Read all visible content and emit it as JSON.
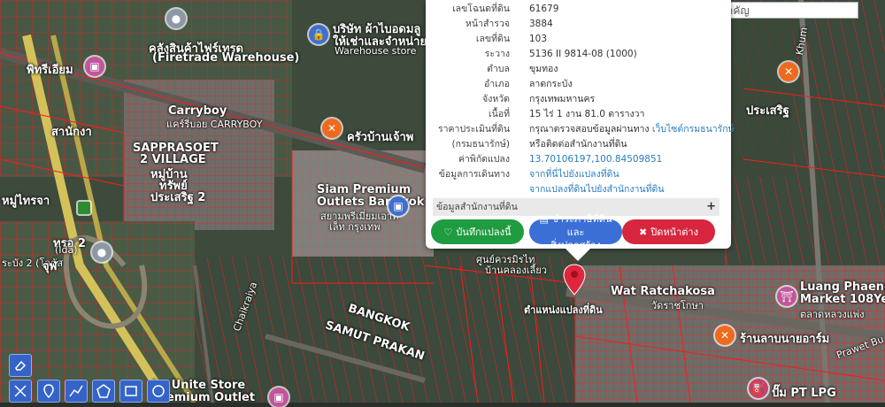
{
  "search": {
    "placeholder": "ค้นหาสถานที่สำคัญ"
  },
  "parcel": {
    "rows": [
      {
        "key": "เลขโฉนดที่ดิน",
        "value": "61679"
      },
      {
        "key": "หน้าสำรวจ",
        "value": "3884"
      },
      {
        "key": "เลขที่ดิน",
        "value": "103"
      },
      {
        "key": "ระวาง",
        "value": "5136 II 9814-08 (1000)"
      },
      {
        "key": "ตำบล",
        "value": "ขุมทอง"
      },
      {
        "key": "อำเภอ",
        "value": "ลาดกระบัง"
      },
      {
        "key": "จังหวัด",
        "value": "กรุงเทพมหานคร"
      },
      {
        "key": "เนื้อที่",
        "value": "15 ไร่ 1 งาน 81.0 ตารางวา"
      }
    ],
    "price_key": "ราคาประเมินที่ดิน",
    "price_key2": "(กรมธนารักษ์)",
    "price_value": "กรุณาตรวจสอบข้อมูลผ่านทาง",
    "price_link": "เว็บไซต์กรมธนารักษ์",
    "price_value2": "หรือติดต่อสำนักงานที่ดิน",
    "coord_key": "ค่าพิกัดแปลง",
    "coord_value": "13.70106197,100.84509851",
    "travel_key": "ข้อมูลการเดินทาง",
    "travel_link1": "จากที่นี่ไปยังแปลงที่ดิน",
    "travel_link2": "จากแปลงที่ดินไปยังสำนักงานที่ดิน",
    "office_label": "ข้อมูลสำนักงานที่ดิน",
    "office_plus": "+",
    "save_button": "บันทึกแปลงนี้",
    "pay_button_line1": "ชำระภาษีที่ดินและ",
    "pay_button_line2": "สิ่งปลูกสร้าง",
    "close_button": "ปิดหน้าต่าง"
  },
  "marker_label": "ตำแหน่งแปลงที่ดิน",
  "map_labels": {
    "firetrade_th": "คลังสินค้าไฟร์เทรด",
    "firetrade_en": "(Firetrade Warehouse)",
    "warehouse_th": "บริษัท ผ้าไบอดมลู",
    "warehouse_th2": "ให้เช่าและจำหน่าย",
    "warehouse_store": "Warehouse store",
    "carryboy_en": "Carryboy",
    "carryboy_th": "แคร์รี่บอย CARRYBOY",
    "krua": "ครัวบ้านเจ้าพ",
    "sapprasoet1": "SAPPRASOET",
    "sapprasoet2": "2 VILLAGE",
    "sapprasoet3": "หมู่บ้าน",
    "sapprasoet4": "ทรัพย์",
    "sapprasoet5": "ประเสริฐ 2",
    "siam1": "Siam Premium",
    "siam2": "Outlets Bangkok",
    "siam3": "สยามพรีเมี่ยมเอาท์",
    "siam4": "เล็ท กรุงเทพ",
    "pittrium": "พิทรีเอียม",
    "tesco_partial": "ทรอ 2",
    "lotus": "ระบัง 2 (โลตัส",
    "bangkok": "BANGKOK",
    "samut": "SAMUT PRAKAN",
    "chaikraiya": "Chaikraiya",
    "wat1": "Wat Ratchakosa",
    "wat2": "วัดราชโกษา",
    "luang1": "Luang Phaeng",
    "luang2": "Market 108Ye",
    "luang3": "ตลาดหลวงแพ่ง",
    "ranlan": "ร้านลาบนายอาร์ม",
    "ptlpg": "ปั๊ม PT LPG",
    "prasert": "ประเสริฐ",
    "unite1": "ke Unite Store",
    "unite2": "Premium Outlet",
    "prawet": "Prawet Bu",
    "khum": "Khum",
    "ida": "(Ida)",
    "jaupaira": "จุฬ",
    "tvt": "หมู่ไทรจา",
    "sanan": "สานักงา",
    "sankan": "ศูนย์ควรมิรไท",
    "ban_khlong": "บ้านคลองเลี้ยว"
  },
  "colors": {
    "parcel_line": "#ff1a1a",
    "save": "#1f9b40",
    "pay": "#3b6fd6",
    "close": "#d7263d",
    "link": "#2a7bbf",
    "marker": "#e0263e",
    "toolbar": "#3564c8"
  },
  "icons": [
    "eraser-icon",
    "measure-icon",
    "pin-icon",
    "polyline-icon",
    "polygon-icon",
    "rectangle-icon",
    "circle-icon",
    "heart-icon",
    "receipt-icon",
    "close-x-icon",
    "lock-icon",
    "bag-icon"
  ]
}
